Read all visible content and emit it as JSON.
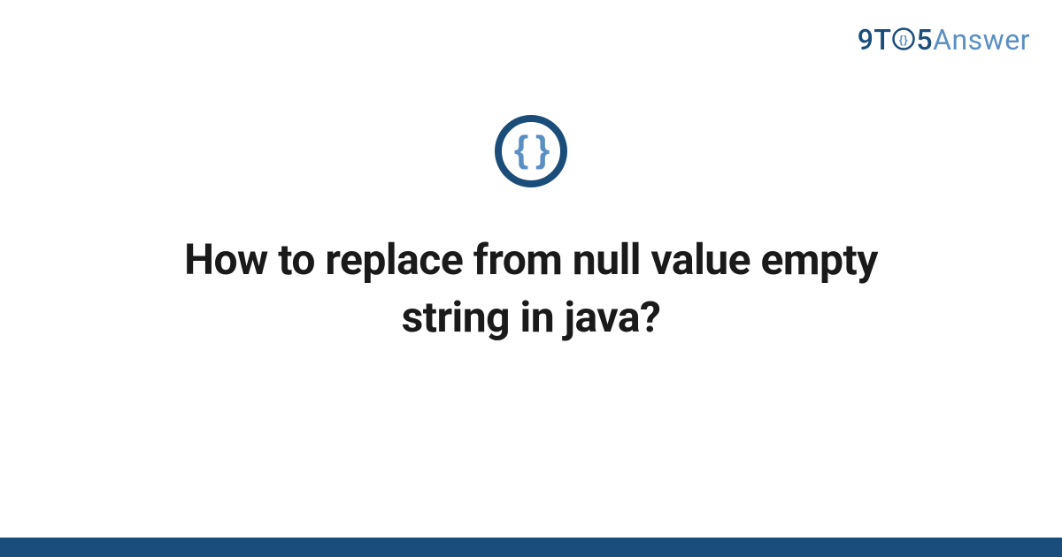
{
  "logo": {
    "nine": "9",
    "t": "T",
    "five": "5",
    "answer": "Answer"
  },
  "icon": {
    "braces": "{ }"
  },
  "title": "How to replace from null value empty string in java?",
  "colors": {
    "primary": "#1a4d7a",
    "secondary": "#5a8fc4",
    "text": "#1a1a1a"
  }
}
